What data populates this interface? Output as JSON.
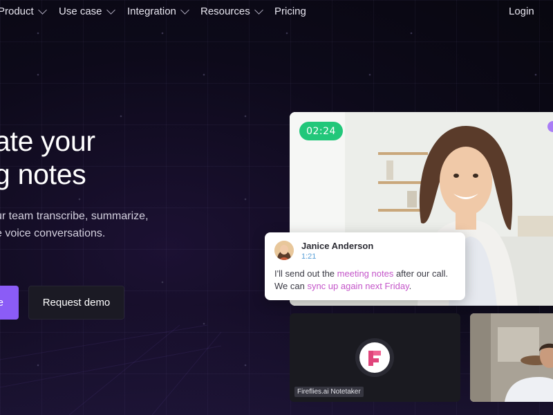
{
  "nav": {
    "items": [
      {
        "label": "Product",
        "has_dropdown": true
      },
      {
        "label": "Use case",
        "has_dropdown": true
      },
      {
        "label": "Integration",
        "has_dropdown": true
      },
      {
        "label": "Resources",
        "has_dropdown": true
      },
      {
        "label": "Pricing",
        "has_dropdown": false
      }
    ],
    "login_label": "Login"
  },
  "hero": {
    "headline_line1": "ate your",
    "headline_line2": "g notes",
    "subtext_line1": "ur team transcribe, summarize,",
    "subtext_line2": "e voice conversations.",
    "primary_button_label": "e",
    "secondary_button_label": "Request demo"
  },
  "meeting": {
    "timer": "02:24",
    "transcript": {
      "speaker": "Janice Anderson",
      "time": "1:21",
      "text_part1": "I'll send out the ",
      "highlight1": "meeting notes",
      "text_part2": " after our call. We can ",
      "highlight2": "sync up again next Friday",
      "text_part3": "."
    },
    "notetaker_label": "Fireflies.ai Notetaker"
  },
  "colors": {
    "accent": "#8b5cf6",
    "timer": "#22c77a",
    "highlight": "#c455c9",
    "background": "#0d0a1a"
  },
  "icons": [
    "chevron-down-icon",
    "fireflies-logo-icon",
    "avatar-icon"
  ]
}
